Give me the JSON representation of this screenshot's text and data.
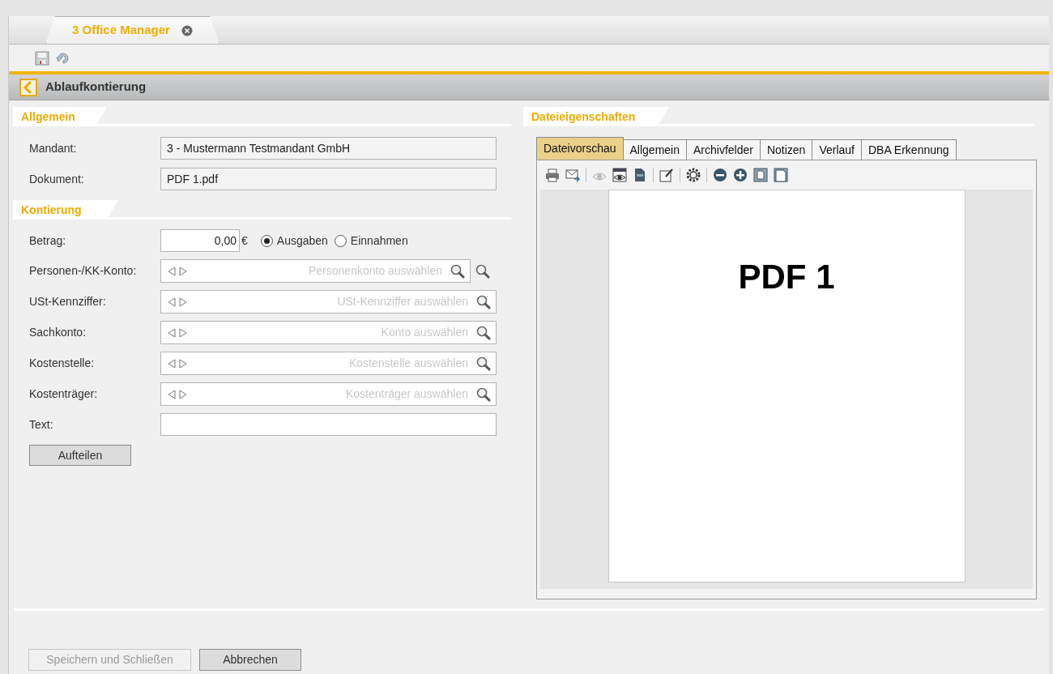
{
  "app_tab": {
    "label": "3 Office Manager",
    "selected": true
  },
  "header": {
    "title": "Ablaufkontierung"
  },
  "general": {
    "title": "Allgemein",
    "fields": [
      {
        "label": "Mandant:",
        "value": "3 - Mustermann Testmandant GmbH"
      },
      {
        "label": "Dokument:",
        "value": "PDF 1.pdf"
      }
    ]
  },
  "kontierung": {
    "title": "Kontierung",
    "amount": {
      "label": "Betrag:",
      "value": "0,00",
      "currency": "€"
    },
    "radios": [
      {
        "label": "Ausgaben",
        "selected": true
      },
      {
        "label": "Einnahmen",
        "selected": false
      }
    ],
    "lookups": [
      {
        "label": "Personen-/KK-Konto:",
        "placeholder": "Personenkonto auswählen",
        "extra_search": true
      },
      {
        "label": "USt-Kennziffer:",
        "placeholder": "USt-Kennziffer auswählen",
        "extra_search": false
      },
      {
        "label": "Sachkonto:",
        "placeholder": "Konto auswählen",
        "extra_search": false
      },
      {
        "label": "Kostenstelle:",
        "placeholder": "Kostenstelle auswählen",
        "extra_search": false
      },
      {
        "label": "Kostenträger:",
        "placeholder": "Kostenträger auswählen",
        "extra_search": false
      }
    ],
    "text": {
      "label": "Text:"
    },
    "split_button": "Aufteilen"
  },
  "file_props": {
    "title": "Dateieigenschaften",
    "tabs": [
      {
        "label": "Dateivorschau",
        "selected": true
      },
      {
        "label": "Allgemein",
        "selected": false
      },
      {
        "label": "Archivfelder",
        "selected": false
      },
      {
        "label": "Notizen",
        "selected": false
      },
      {
        "label": "Verlauf",
        "selected": false
      },
      {
        "label": "DBA Erkennung",
        "selected": false
      }
    ],
    "preview": {
      "heading": "PDF 1"
    }
  },
  "buttons": [
    {
      "label": "Speichern und Schließen",
      "disabled": true
    },
    {
      "label": "Abbrechen",
      "disabled": false
    }
  ]
}
